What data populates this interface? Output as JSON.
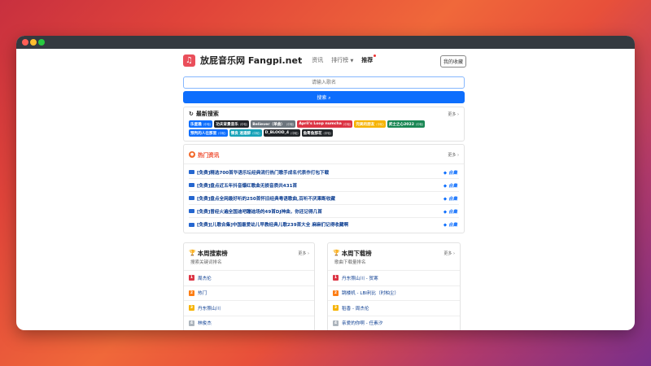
{
  "nav": {
    "logo_glyph": "♫",
    "brand": "放屁音乐网 Fangpi.net",
    "links": [
      "资讯",
      "排行榜",
      "推荐"
    ],
    "fav_button": "我的收藏"
  },
  "search": {
    "placeholder": "请输入歌名",
    "button": "搜索 ⌕"
  },
  "recent": {
    "title": "最新搜索",
    "more": "更多 ›",
    "tags": [
      {
        "name": "乐星雅",
        "suffix": "(中轮)",
        "color": "#0d6efd"
      },
      {
        "name": "功夫背景音乐",
        "suffix": "(中轮)",
        "color": "#212529"
      },
      {
        "name": "Believer（单曲）",
        "suffix": "(中轮)",
        "color": "#6c757d"
      },
      {
        "name": "April's Loop numcha",
        "suffix": "(中轮)",
        "color": "#dc3545"
      },
      {
        "name": "完美的朋友",
        "suffix": "(中轮)",
        "color": "#f6b300"
      },
      {
        "name": "武士之心2022",
        "suffix": "(中轮)",
        "color": "#198754"
      },
      {
        "name": "预判的人在那里",
        "suffix": "(中轮)",
        "color": "#0d6efd"
      },
      {
        "name": "情良 逍遥醉",
        "suffix": "(中轮)",
        "color": "#17a2b8"
      },
      {
        "name": "D_BLOOD_4",
        "suffix": "(中轮)",
        "color": "#212529"
      },
      {
        "name": "鱼哥鱼那花",
        "suffix": "(中轮)",
        "color": "#212529"
      }
    ]
  },
  "hot": {
    "title": "热门资讯",
    "more": "更多 ›",
    "tag_label": "合集",
    "items": [
      "[免费]精选700首华语乐坛经典流行热门歌手成名代表作打包下载",
      "[免费]盘点近五年抖音爆红歌曲无损音质共431首",
      "[免费]盘点全网最好听的250首怀旧经典粤语歌曲,百听不厌果断收藏",
      "[免费]曾经火遍全国迪吧蹦迪场的49首DJ神曲，你还记得几首",
      "[免费][儿歌合集]中国最爱幼儿早教经典儿歌239首大全 麻麻们记得收藏啊"
    ]
  },
  "rank_search": {
    "title": "本周搜索榜",
    "subtitle": "搜索关键词排名",
    "more": "更多 ›",
    "items": [
      "周杰伦",
      "热门",
      "丹东照山川",
      "林俊杰"
    ]
  },
  "rank_download": {
    "title": "本周下载榜",
    "subtitle": "歌曲下载量排名",
    "more": "更多 ›",
    "items": [
      "丹东照山川 - 贺寒",
      "跳楼机 - LBI利比（时柏尘）",
      "稻香 - 周杰伦",
      "亲爱的你啊 - 任素汐"
    ]
  }
}
